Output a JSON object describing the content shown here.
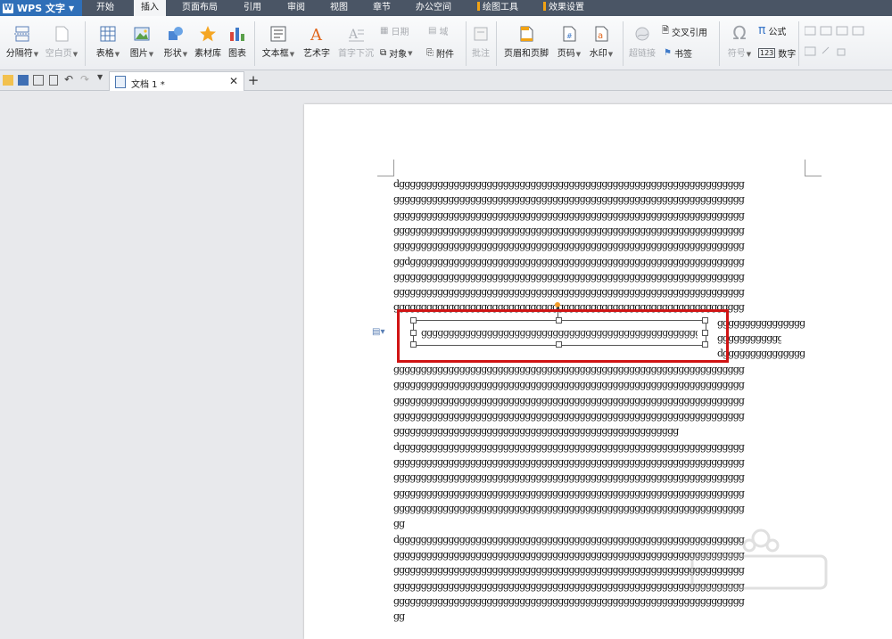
{
  "app": {
    "name": "WPS 文字"
  },
  "menu_tabs": [
    {
      "label": "开始"
    },
    {
      "label": "插入"
    },
    {
      "label": "页面布局"
    },
    {
      "label": "引用"
    },
    {
      "label": "审阅"
    },
    {
      "label": "视图"
    },
    {
      "label": "章节"
    },
    {
      "label": "办公空间"
    },
    {
      "label": "绘图工具"
    },
    {
      "label": "效果设置"
    }
  ],
  "active_tab": "插入",
  "ribbon": {
    "page_break": "分隔符",
    "blank_page": "空白页",
    "table": "表格",
    "picture": "图片",
    "shape": "形状",
    "material": "素材库",
    "chart": "图表",
    "textbox": "文本框",
    "wordart": "艺术字",
    "drop_cap": "首字下沉",
    "date": "日期",
    "field": "域",
    "object": "对象",
    "attachment": "附件",
    "comment": "批注",
    "header_footer": "页眉和页脚",
    "page_number": "页码",
    "watermark": "水印",
    "hyperlink": "超链接",
    "cross_ref": "交叉引用",
    "bookmark": "书签",
    "symbol": "符号",
    "formula": "公式",
    "number": "数字"
  },
  "document": {
    "tab_title": "文档 1 *"
  },
  "body_lines": [
    "dggggggggggggggggggggggggggggggggggggggggggggggggggggggggggggggg",
    "gggggggggggggggggggggggggggggggggggggggggggggggggggggggggggggggg",
    "gggggggggggggggggggggggggggggggggggggggggggggggggggggggggggggggg",
    "gggggggggggggggggggggggggggggggggggggggggggggggggggggggggggggggg",
    "gggggggggggggggggggggggggggggggggggggggggggggggggggggggggggggggg",
    "ggdggggggggggggggggggggggggggggggggggggggggggggggggggggggggggggg",
    "gggggggggggggggggggggggggggggggggggggggggggggggggggggggggggggggg",
    "gggggggggggggggggggggggggggggggggggggggggggggggggggggggggggggggg",
    "gggggggggggggggggggggggggggggggggggggggggggggggggggggggggggggggg"
  ],
  "wrap_lines": [
    "gggggggggggggggg",
    "gggggggggggg",
    "dgggggggggggggggg"
  ],
  "textbox_text": "gggggggggggggggggggggggggggggggggggggggggggggggggggggggg",
  "body_lines_2": [
    "gggggggggggggggggggggggggggggggggggggggggggggggggggggggggggggggg",
    "gggggggggggggggggggggggggggggggggggggggggggggggggggggggggggggggg",
    "gggggggggggggggggggggggggggggggggggggggggggggggggggggggggggggggg",
    "gggggggggggggggggggggggggggggggggggggggggggggggggggggggggggggggg",
    "gggggggggggggggggggggggggggggggggggggggggggggggggggg",
    "dggggggggggggggggggggggggggggggggggggggggggggggggggggggggggggggg",
    "gggggggggggggggggggggggggggggggggggggggggggggggggggggggggggggggg",
    "gggggggggggggggggggggggggggggggggggggggggggggggggggggggggggggggg",
    "gggggggggggggggggggggggggggggggggggggggggggggggggggggggggggggggg",
    "gggggggggggggggggggggggggggggggggggggggggggggggggggggggggggggggg",
    "gg",
    "dggggggggggggggggggggggggggggggggggggggggggggggggggggggggggggggg",
    "gggggggggggggggggggggggggggggggggggggggggggggggggggggggggggggggg",
    "gggggggggggggggggggggggggggggggggggggggggggggggggggggggggggggggg",
    "gggggggggggggggggggggggggggggggggggggggggggggggggggggggggggggggg",
    "gggggggggggggggggggggggggggggggggggggggggggggggggggggggggggggggg",
    "gg"
  ],
  "colors": {
    "highlight": "#d01414",
    "accent": "#2f6fb8",
    "tool_tab_marker": "#f2a314"
  }
}
